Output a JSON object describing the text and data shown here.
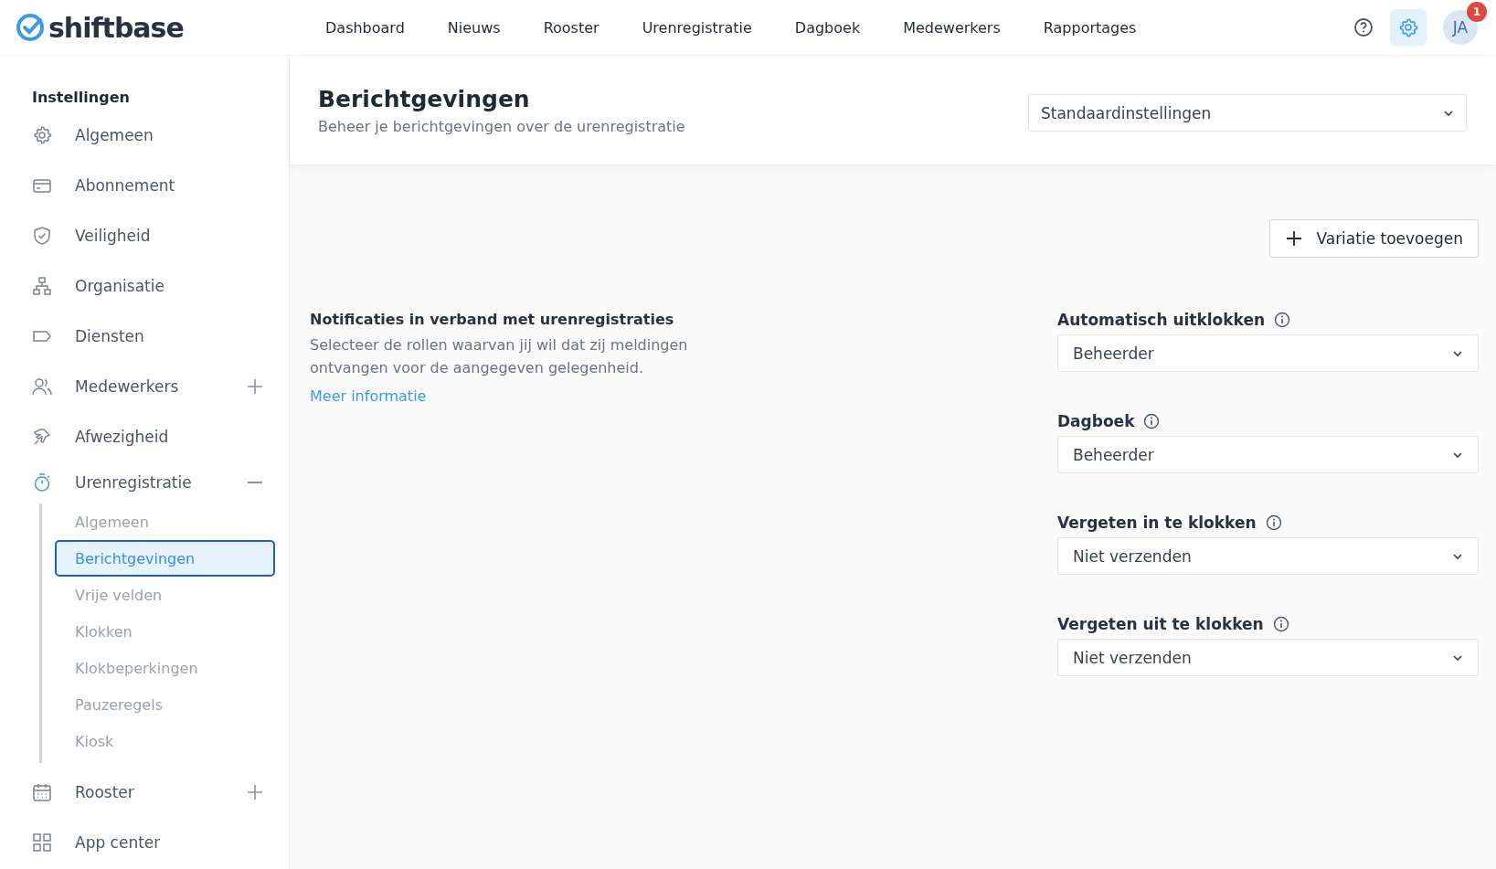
{
  "header": {
    "logo": "shiftbase",
    "nav": [
      "Dashboard",
      "Nieuws",
      "Rooster",
      "Urenregistratie",
      "Dagboek",
      "Medewerkers",
      "Rapportages"
    ],
    "settings_selected": true,
    "avatar": "JA",
    "badge": "1"
  },
  "sidebar": {
    "title": "Instellingen",
    "items": [
      {
        "label": "Algemeen"
      },
      {
        "label": "Abonnement"
      },
      {
        "label": "Veiligheid"
      },
      {
        "label": "Organisatie"
      },
      {
        "label": "Diensten"
      },
      {
        "label": "Medewerkers",
        "expanded": false
      },
      {
        "label": "Afwezigheid"
      },
      {
        "label": "Urenregistratie",
        "expanded": true,
        "children": [
          {
            "label": "Algemeen",
            "selected": false
          },
          {
            "label": "Berichtgevingen",
            "selected": true
          },
          {
            "label": "Vrije velden",
            "selected": false
          },
          {
            "label": "Klokken",
            "selected": false
          },
          {
            "label": "Klokbeperkingen",
            "selected": false
          },
          {
            "label": "Pauzeregels",
            "selected": false
          },
          {
            "label": "Kiosk",
            "selected": false
          }
        ]
      },
      {
        "label": "Rooster",
        "expanded": false
      },
      {
        "label": "App center"
      }
    ]
  },
  "page": {
    "title": "Berichtgevingen",
    "subtitle": "Beheer je berichtgevingen over de urenregistratie",
    "preset": "Standaardinstellingen"
  },
  "add_button": "Variatie toevoegen",
  "section": {
    "title": "Notificaties in verband met urenregistraties",
    "description": "Selecteer de rollen waarvan jij wil dat zij meldingen ontvangen voor de aangegeven gelegenheid.",
    "link": "Meer informatie"
  },
  "fields": [
    {
      "label": "Automatisch uitklokken",
      "value": "Beheerder"
    },
    {
      "label": "Dagboek",
      "value": "Beheerder"
    },
    {
      "label": "Vergeten in te klokken",
      "value": "Niet verzenden"
    },
    {
      "label": "Vergeten uit te klokken",
      "value": "Niet verzenden"
    }
  ]
}
